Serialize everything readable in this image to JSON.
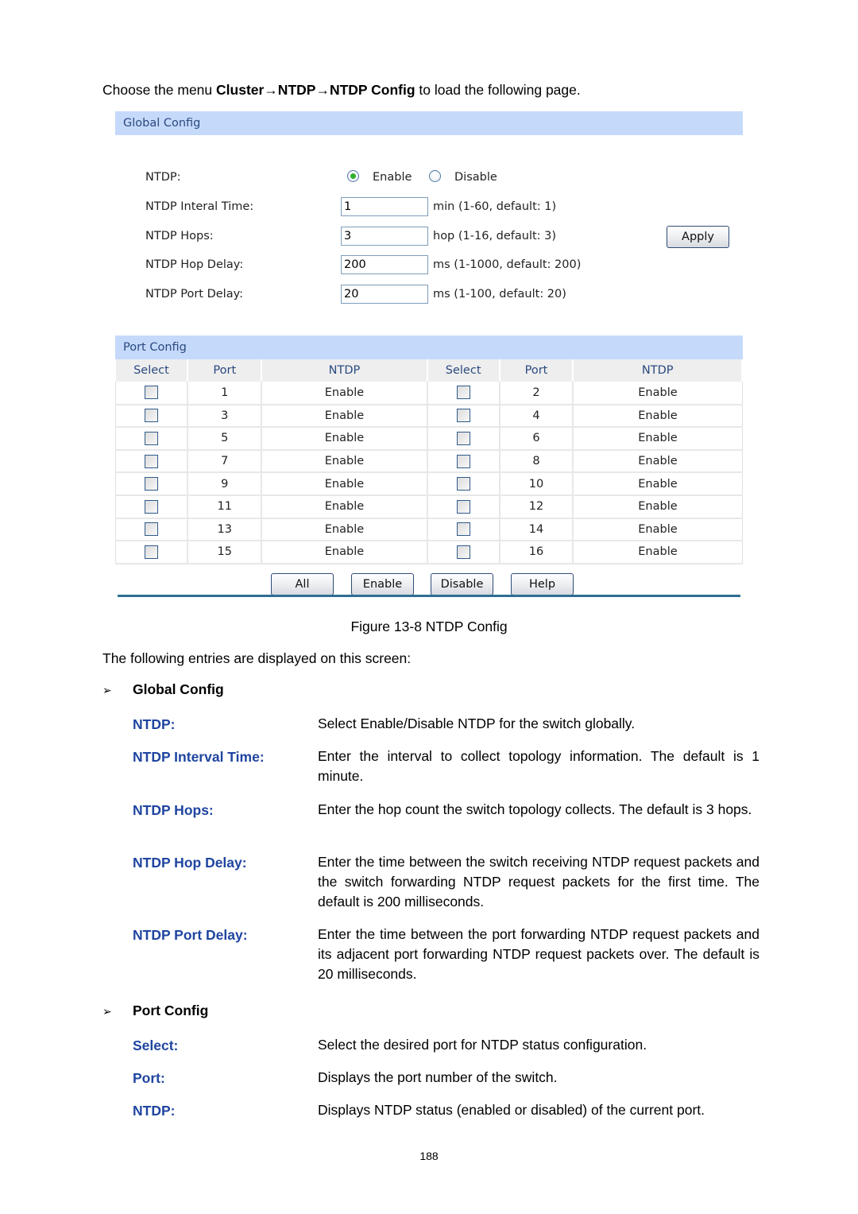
{
  "intro": {
    "prefix": "Choose the menu ",
    "menu_path": "Cluster→NTDP→NTDP Config",
    "suffix": " to load the following page."
  },
  "global_config": {
    "title": "Global Config",
    "ntdp_label": "NTDP:",
    "ntdp_options": [
      {
        "label": "Enable",
        "selected": true
      },
      {
        "label": "Disable",
        "selected": false
      }
    ],
    "fields": [
      {
        "label": "NTDP Interal Time:",
        "value": "1",
        "hint": "min (1-60, default: 1)"
      },
      {
        "label": "NTDP Hops:",
        "value": "3",
        "hint": "hop (1-16, default: 3)"
      },
      {
        "label": "NTDP Hop Delay:",
        "value": "200",
        "hint": "ms (1-1000, default: 200)"
      },
      {
        "label": "NTDP Port Delay:",
        "value": "20",
        "hint": "ms (1-100, default: 20)"
      }
    ],
    "apply_label": "Apply"
  },
  "port_config": {
    "title": "Port Config",
    "headers": [
      "Select",
      "Port",
      "NTDP",
      "Select",
      "Port",
      "NTDP"
    ],
    "rows": [
      {
        "left": {
          "port": "1",
          "ntdp": "Enable",
          "checked": false
        },
        "right": {
          "port": "2",
          "ntdp": "Enable",
          "checked": false
        }
      },
      {
        "left": {
          "port": "3",
          "ntdp": "Enable",
          "checked": false
        },
        "right": {
          "port": "4",
          "ntdp": "Enable",
          "checked": false
        }
      },
      {
        "left": {
          "port": "5",
          "ntdp": "Enable",
          "checked": false
        },
        "right": {
          "port": "6",
          "ntdp": "Enable",
          "checked": false
        }
      },
      {
        "left": {
          "port": "7",
          "ntdp": "Enable",
          "checked": false
        },
        "right": {
          "port": "8",
          "ntdp": "Enable",
          "checked": false
        }
      },
      {
        "left": {
          "port": "9",
          "ntdp": "Enable",
          "checked": false
        },
        "right": {
          "port": "10",
          "ntdp": "Enable",
          "checked": false
        }
      },
      {
        "left": {
          "port": "11",
          "ntdp": "Enable",
          "checked": false
        },
        "right": {
          "port": "12",
          "ntdp": "Enable",
          "checked": false
        }
      },
      {
        "left": {
          "port": "13",
          "ntdp": "Enable",
          "checked": false
        },
        "right": {
          "port": "14",
          "ntdp": "Enable",
          "checked": false
        }
      },
      {
        "left": {
          "port": "15",
          "ntdp": "Enable",
          "checked": false
        },
        "right": {
          "port": "16",
          "ntdp": "Enable",
          "checked": false
        }
      }
    ],
    "buttons": [
      "All",
      "Enable",
      "Disable",
      "Help"
    ]
  },
  "figure_caption": "Figure 13-8 NTDP Config",
  "entries_intro": "The following entries are displayed on this screen:",
  "sections": [
    {
      "title": "Global Config",
      "items": [
        {
          "term": "NTDP:",
          "desc": "Select Enable/Disable NTDP for the switch globally."
        },
        {
          "term": "NTDP Interval Time:",
          "desc": "Enter the interval to collect topology information. The default is 1 minute."
        },
        {
          "term": "NTDP Hops:",
          "desc": "Enter the hop count the switch topology collects. The default is 3 hops."
        },
        {
          "term": "NTDP Hop Delay:",
          "desc": "Enter the time between the switch receiving NTDP request packets and the switch forwarding NTDP request packets for the first time. The default is 200 milliseconds."
        },
        {
          "term": "NTDP Port Delay:",
          "desc": "Enter the time between the port forwarding NTDP request packets and its adjacent port forwarding NTDP request packets over. The default is 20 milliseconds."
        }
      ]
    },
    {
      "title": "Port Config",
      "items": [
        {
          "term": "Select:",
          "desc": "Select the desired port for NTDP status configuration."
        },
        {
          "term": "Port:",
          "desc": "Displays the port number of the switch."
        },
        {
          "term": "NTDP:",
          "desc": "Displays NTDP status (enabled or disabled) of the current port."
        }
      ]
    }
  ],
  "bullet_icon": "arrowhead-right-icon",
  "page_number": "188",
  "colors": {
    "section_header_bg": "#c5d9fb",
    "section_header_text": "#2a4a80",
    "term_color": "#1f45a0",
    "figure_rule": "#2e6e94",
    "radio_selected": "#2fb12f"
  }
}
